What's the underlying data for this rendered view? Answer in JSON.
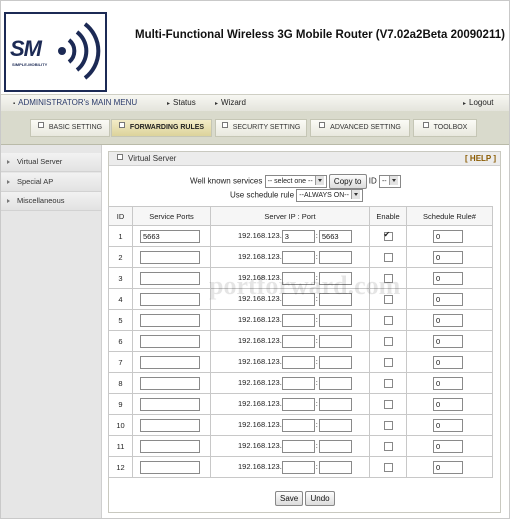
{
  "app": {
    "title": "Multi-Functional Wireless 3G Mobile Router (V7.02a2Beta 20090211)",
    "logo_text": "SM",
    "logo_subtext": "SIMPLE-MOBILITY"
  },
  "menubar": {
    "main_menu": "ADMINISTRATOR's MAIN MENU",
    "status": "Status",
    "wizard": "Wizard",
    "logout": "Logout"
  },
  "tabs": [
    {
      "label": "BASIC SETTING",
      "active": false
    },
    {
      "label": "FORWARDING RULES",
      "active": true
    },
    {
      "label": "SECURITY SETTING",
      "active": false
    },
    {
      "label": "ADVANCED SETTING",
      "active": false
    },
    {
      "label": "TOOLBOX",
      "active": false
    }
  ],
  "sidebar": {
    "items": [
      {
        "label": "Virtual Server"
      },
      {
        "label": "Special AP"
      },
      {
        "label": "Miscellaneous"
      }
    ]
  },
  "panel": {
    "title": "Virtual Server",
    "help": "[ HELP ]",
    "well_known_label": "Well known services",
    "well_known_value": "-- select one --",
    "copy_button": "Copy to",
    "id_label": "ID",
    "id_value": "--",
    "schedule_label": "Use schedule rule",
    "schedule_value": "--ALWAYS ON--"
  },
  "table": {
    "headers": [
      "ID",
      "Service Ports",
      "Server IP : Port",
      "Enable",
      "Schedule Rule#"
    ],
    "ip_prefix": "192.168.123.",
    "rows": [
      {
        "id": "1",
        "ports": "5663",
        "ip_last": "3",
        "port": "5663",
        "enabled": true,
        "schedule": "0"
      },
      {
        "id": "2",
        "ports": "",
        "ip_last": "",
        "port": "",
        "enabled": false,
        "schedule": "0"
      },
      {
        "id": "3",
        "ports": "",
        "ip_last": "",
        "port": "",
        "enabled": false,
        "schedule": "0"
      },
      {
        "id": "4",
        "ports": "",
        "ip_last": "",
        "port": "",
        "enabled": false,
        "schedule": "0"
      },
      {
        "id": "5",
        "ports": "",
        "ip_last": "",
        "port": "",
        "enabled": false,
        "schedule": "0"
      },
      {
        "id": "6",
        "ports": "",
        "ip_last": "",
        "port": "",
        "enabled": false,
        "schedule": "0"
      },
      {
        "id": "7",
        "ports": "",
        "ip_last": "",
        "port": "",
        "enabled": false,
        "schedule": "0"
      },
      {
        "id": "8",
        "ports": "",
        "ip_last": "",
        "port": "",
        "enabled": false,
        "schedule": "0"
      },
      {
        "id": "9",
        "ports": "",
        "ip_last": "",
        "port": "",
        "enabled": false,
        "schedule": "0"
      },
      {
        "id": "10",
        "ports": "",
        "ip_last": "",
        "port": "",
        "enabled": false,
        "schedule": "0"
      },
      {
        "id": "11",
        "ports": "",
        "ip_last": "",
        "port": "",
        "enabled": false,
        "schedule": "0"
      },
      {
        "id": "12",
        "ports": "",
        "ip_last": "",
        "port": "",
        "enabled": false,
        "schedule": "0"
      }
    ]
  },
  "actions": {
    "save": "Save",
    "undo": "Undo"
  },
  "watermark": "portforward.com",
  "colors": {
    "brand": "#1c2a55",
    "active_tab": "#dcd39b",
    "help": "#8a5a00"
  }
}
